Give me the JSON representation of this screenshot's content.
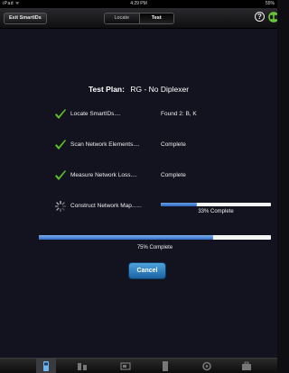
{
  "status_bar": {
    "signal": "iPad ᯤ",
    "time": "4:29 PM",
    "battery": "55%"
  },
  "nav": {
    "exit_label": "Exit SmartIDs",
    "segments": [
      {
        "label": "Locate",
        "selected": false
      },
      {
        "label": "Test",
        "selected": true
      }
    ],
    "help_label": "?"
  },
  "test_plan": {
    "label": "Test Plan:",
    "value": "RG - No Diplexer"
  },
  "tasks": [
    {
      "label": "Locate SmartIDs....",
      "status": "Found 2:  B, K",
      "state": "done"
    },
    {
      "label": "Scan Network Elements....",
      "status": "Complete",
      "state": "done"
    },
    {
      "label": "Measure Network Loss....",
      "status": "Complete",
      "state": "done"
    },
    {
      "label": "Construct Network Map......",
      "status": "",
      "state": "in-progress"
    }
  ],
  "current_task_progress": {
    "percent": 33,
    "text": "33% Complete"
  },
  "overall_progress": {
    "percent": 75,
    "text": "75% Complete"
  },
  "cancel_label": "Cancel",
  "colors": {
    "check": "#5dc02a",
    "progress": "#2f6ac4",
    "button": "#2a7cc0"
  },
  "tabs": [
    {
      "icon": "meter-icon",
      "active": true
    },
    {
      "icon": "devices-icon",
      "active": false
    },
    {
      "icon": "monitor-icon",
      "active": false
    },
    {
      "icon": "document-icon",
      "active": false
    },
    {
      "icon": "settings-icon",
      "active": false
    },
    {
      "icon": "toolbox-icon",
      "active": false
    }
  ]
}
